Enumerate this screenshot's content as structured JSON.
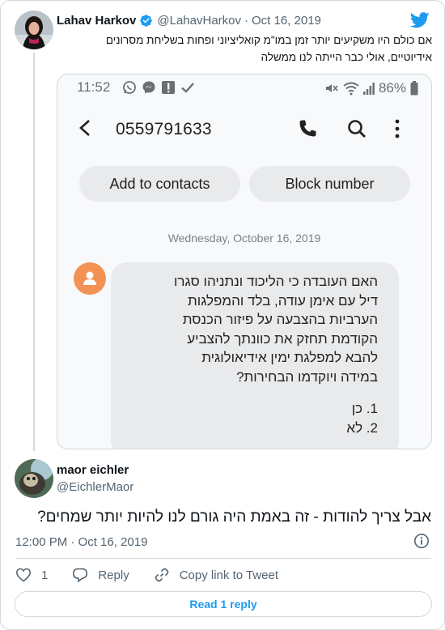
{
  "colors": {
    "accent": "#1d9bf0",
    "text": "#0f1419",
    "muted": "#536471",
    "border": "#cfd9de"
  },
  "tweet": {
    "name": "Lahav Harkov",
    "handle": "@LahavHarkov",
    "separator": "·",
    "date": "Oct 16, 2019",
    "text_line1": "אם כולם היו משקיעים יותר זמן במו\"מ קואליציוני ופחות בשליחת מסרונים",
    "text_line2": "אידיוטיים, אולי כבר הייתה לנו ממשלה",
    "verified_icon": "verified-badge-icon",
    "brand_icon": "twitter-bird-icon"
  },
  "screenshot": {
    "status_time": "11:52",
    "battery": "86%",
    "phone_number": "0559791633",
    "add_contacts_label": "Add to contacts",
    "block_label": "Block number",
    "date_separator": "Wednesday, October 16, 2019",
    "message_lines": [
      "האם העובדה כי הליכוד ונתניהו סגרו",
      "דיל עם אימן עודה, בלד והמפלגות",
      "הערביות בהצבעה על פיזור הכנסת",
      "הקודמת תחזק את כוונתך להצביע",
      "להבא למפלגת ימין אידיאולוגית",
      "במידה ויוקדמו הבחירות?"
    ],
    "option1": "1. כן",
    "option2": "2. לא"
  },
  "reply": {
    "name": "maor eichler",
    "handle": "@EichlerMaor",
    "text": "אבל צריך להודות - זה באמת היה גורם לנו להיות יותר שמחים?",
    "time": "12:00 PM · Oct 16, 2019",
    "like_count": "1",
    "reply_label": "Reply",
    "copy_link_label": "Copy link to Tweet",
    "read_replies_label": "Read 1 reply"
  }
}
